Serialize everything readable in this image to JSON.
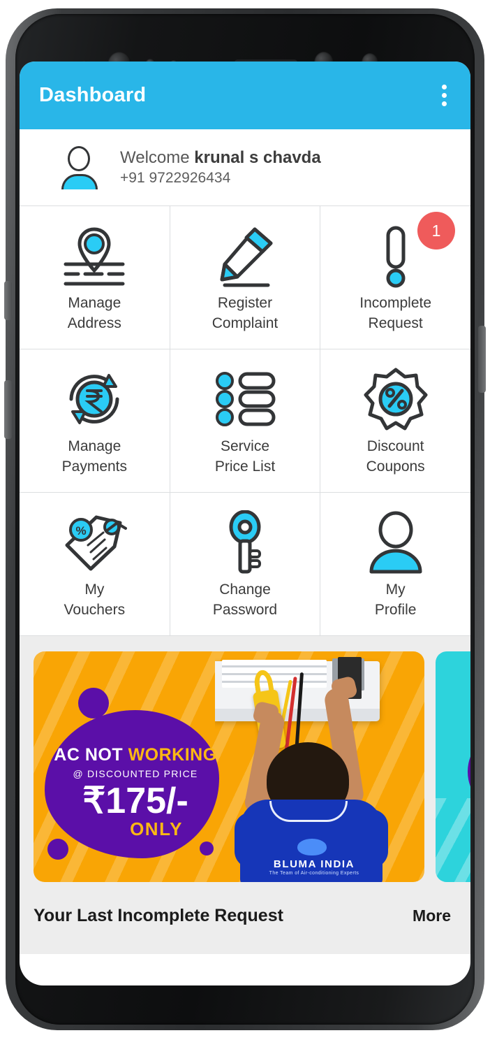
{
  "app": {
    "title": "Dashboard",
    "accent_color": "#29B6E8",
    "badge_color": "#EF5B5B",
    "icon_accent": "#2ACCF5",
    "menu_icon": "kebab-menu-icon"
  },
  "welcome": {
    "greeting": "Welcome ",
    "user_name": "krunal s chavda",
    "phone": "+91 9722926434",
    "avatar_icon": "user-avatar-icon"
  },
  "grid": {
    "items": [
      {
        "label_line1": "Manage",
        "label_line2": "Address",
        "icon": "location-pin-icon",
        "badge": ""
      },
      {
        "label_line1": "Register",
        "label_line2": "Complaint",
        "icon": "pencil-edit-icon",
        "badge": ""
      },
      {
        "label_line1": "Incomplete",
        "label_line2": "Request",
        "icon": "exclamation-mark-icon",
        "badge": "1"
      },
      {
        "label_line1": "Manage",
        "label_line2": "Payments",
        "icon": "rupee-refresh-icon",
        "badge": ""
      },
      {
        "label_line1": "Service",
        "label_line2": "Price List",
        "icon": "bullet-list-icon",
        "badge": ""
      },
      {
        "label_line1": "Discount",
        "label_line2": "Coupons",
        "icon": "percent-badge-icon",
        "badge": ""
      },
      {
        "label_line1": "My",
        "label_line2": "Vouchers",
        "icon": "voucher-tag-icon",
        "badge": ""
      },
      {
        "label_line1": "Change",
        "label_line2": "Password",
        "icon": "key-icon",
        "badge": ""
      },
      {
        "label_line1": "My",
        "label_line2": "Profile",
        "icon": "person-profile-icon",
        "badge": ""
      }
    ]
  },
  "banners": {
    "primary": {
      "headline_white": "AC NOT ",
      "headline_accent": "WORKING",
      "subline": "@ DISCOUNTED PRICE",
      "price": "₹175/-",
      "price_suffix": "ONLY",
      "brand_name": "BLUMA INDIA",
      "brand_tagline": "The Team of Air-conditioning Experts",
      "bg_color": "#F9A505",
      "blob_color": "#5B0FA8"
    },
    "secondary": {
      "bg_color": "#2DD3DC",
      "blob_color": "#5B0FA8"
    }
  },
  "footer": {
    "title": "Your Last Incomplete Request",
    "more_label": "More"
  }
}
